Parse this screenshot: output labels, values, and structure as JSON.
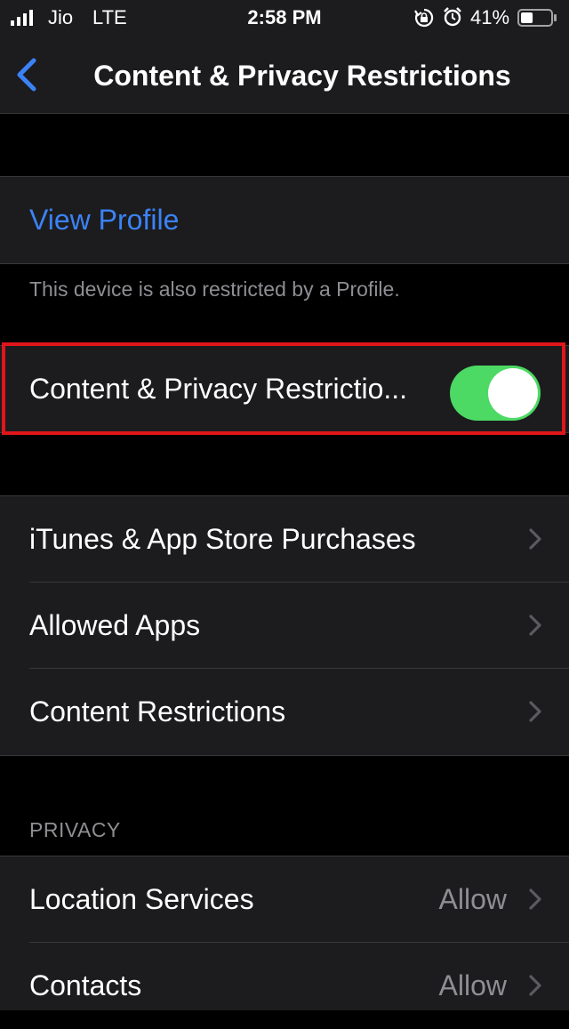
{
  "status_bar": {
    "carrier": "Jio",
    "network": "LTE",
    "time": "2:58 PM",
    "battery_percent": "41%",
    "battery_level": 0.41,
    "icons": [
      "signal-icon",
      "orientation-lock-icon",
      "alarm-icon",
      "battery-icon"
    ]
  },
  "nav": {
    "back_icon": "chevron-left-icon",
    "title": "Content & Privacy Restrictions"
  },
  "profile": {
    "link_label": "View Profile",
    "footer_note": "This device is also restricted by a Profile."
  },
  "master_toggle": {
    "label": "Content & Privacy Restrictio...",
    "state": "on"
  },
  "settings": {
    "items": [
      {
        "label": "iTunes & App Store Purchases"
      },
      {
        "label": "Allowed Apps"
      },
      {
        "label": "Content Restrictions"
      }
    ]
  },
  "privacy": {
    "header": "PRIVACY",
    "items": [
      {
        "label": "Location Services",
        "value": "Allow"
      },
      {
        "label": "Contacts",
        "value": "Allow"
      }
    ]
  },
  "colors": {
    "accent": "#3b82f6",
    "toggle_on": "#4cd964",
    "highlight": "#e0161b",
    "background": "#000000",
    "cell": "#1c1c1e"
  }
}
